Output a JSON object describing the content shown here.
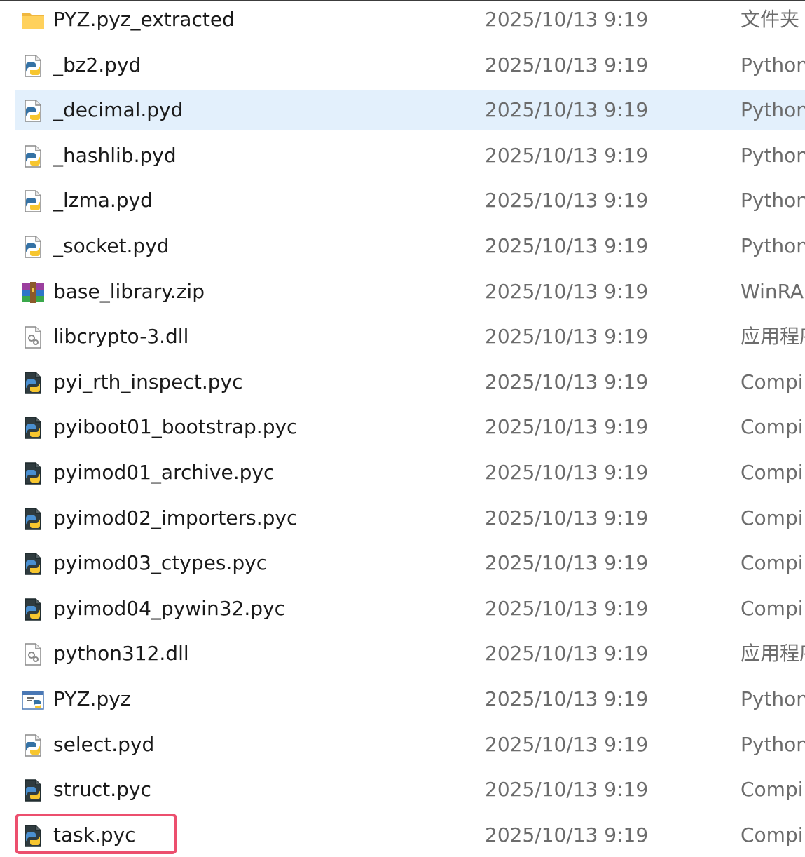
{
  "files": [
    {
      "name": "PYZ.pyz_extracted",
      "date": "2025/10/13 9:19",
      "type": "文件夹",
      "icon": "folder-icon"
    },
    {
      "name": "_bz2.pyd",
      "date": "2025/10/13 9:19",
      "type": "Python",
      "icon": "python-file-icon"
    },
    {
      "name": "_decimal.pyd",
      "date": "2025/10/13 9:19",
      "type": "Python",
      "icon": "python-file-icon"
    },
    {
      "name": "_hashlib.pyd",
      "date": "2025/10/13 9:19",
      "type": "Python",
      "icon": "python-file-icon"
    },
    {
      "name": "_lzma.pyd",
      "date": "2025/10/13 9:19",
      "type": "Python",
      "icon": "python-file-icon"
    },
    {
      "name": "_socket.pyd",
      "date": "2025/10/13 9:19",
      "type": "Python",
      "icon": "python-file-icon"
    },
    {
      "name": "base_library.zip",
      "date": "2025/10/13 9:19",
      "type": "WinRAR",
      "icon": "winrar-archive-icon"
    },
    {
      "name": "libcrypto-3.dll",
      "date": "2025/10/13 9:19",
      "type": "应用程序扩展",
      "icon": "dll-file-icon"
    },
    {
      "name": "pyi_rth_inspect.pyc",
      "date": "2025/10/13 9:19",
      "type": "Compiled",
      "icon": "compiled-python-icon"
    },
    {
      "name": "pyiboot01_bootstrap.pyc",
      "date": "2025/10/13 9:19",
      "type": "Compiled",
      "icon": "compiled-python-icon"
    },
    {
      "name": "pyimod01_archive.pyc",
      "date": "2025/10/13 9:19",
      "type": "Compiled",
      "icon": "compiled-python-icon"
    },
    {
      "name": "pyimod02_importers.pyc",
      "date": "2025/10/13 9:19",
      "type": "Compiled",
      "icon": "compiled-python-icon"
    },
    {
      "name": "pyimod03_ctypes.pyc",
      "date": "2025/10/13 9:19",
      "type": "Compiled",
      "icon": "compiled-python-icon"
    },
    {
      "name": "pyimod04_pywin32.pyc",
      "date": "2025/10/13 9:19",
      "type": "Compiled",
      "icon": "compiled-python-icon"
    },
    {
      "name": "python312.dll",
      "date": "2025/10/13 9:19",
      "type": "应用程序扩展",
      "icon": "dll-file-icon"
    },
    {
      "name": "PYZ.pyz",
      "date": "2025/10/13 9:19",
      "type": "Python",
      "icon": "python-window-icon"
    },
    {
      "name": "select.pyd",
      "date": "2025/10/13 9:19",
      "type": "Python",
      "icon": "python-file-icon"
    },
    {
      "name": "struct.pyc",
      "date": "2025/10/13 9:19",
      "type": "Compiled",
      "icon": "compiled-python-icon"
    },
    {
      "name": "task.pyc",
      "date": "2025/10/13 9:19",
      "type": "Compiled",
      "icon": "compiled-python-icon"
    }
  ],
  "selected_file": "_decimal.pyd",
  "highlighted_file": "task.pyc",
  "colors": {
    "selection": "#e3f0fc",
    "highlight_border": "#ec4f6e",
    "secondary_text": "#6c6c6c"
  }
}
